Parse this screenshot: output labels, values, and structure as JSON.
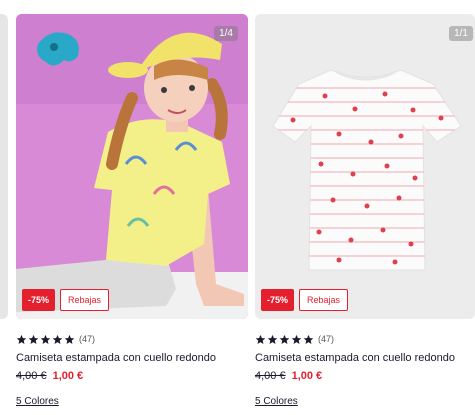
{
  "products": [
    {
      "image_counter": "1/4",
      "discount_badge": "-75%",
      "sale_badge": "Rebajas",
      "review_count": "(47)",
      "rating": 5,
      "title": "Camiseta estampada con cuello redondo",
      "old_price": "4,00 €",
      "new_price": "1,00 €",
      "colors_link": "5 Colores"
    },
    {
      "image_counter": "1/1",
      "discount_badge": "-75%",
      "sale_badge": "Rebajas",
      "review_count": "(47)",
      "rating": 5,
      "title": "Camiseta estampada con cuello redondo",
      "old_price": "4,00 €",
      "new_price": "1,00 €",
      "colors_link": "5 Colores"
    }
  ],
  "colors": {
    "accent_red": "#e4202e",
    "text_dark": "#1a1a2e",
    "photo_background_pink": "#d98ad6",
    "photo_background_grey": "#ececec"
  },
  "icons": [
    "star-icon"
  ]
}
